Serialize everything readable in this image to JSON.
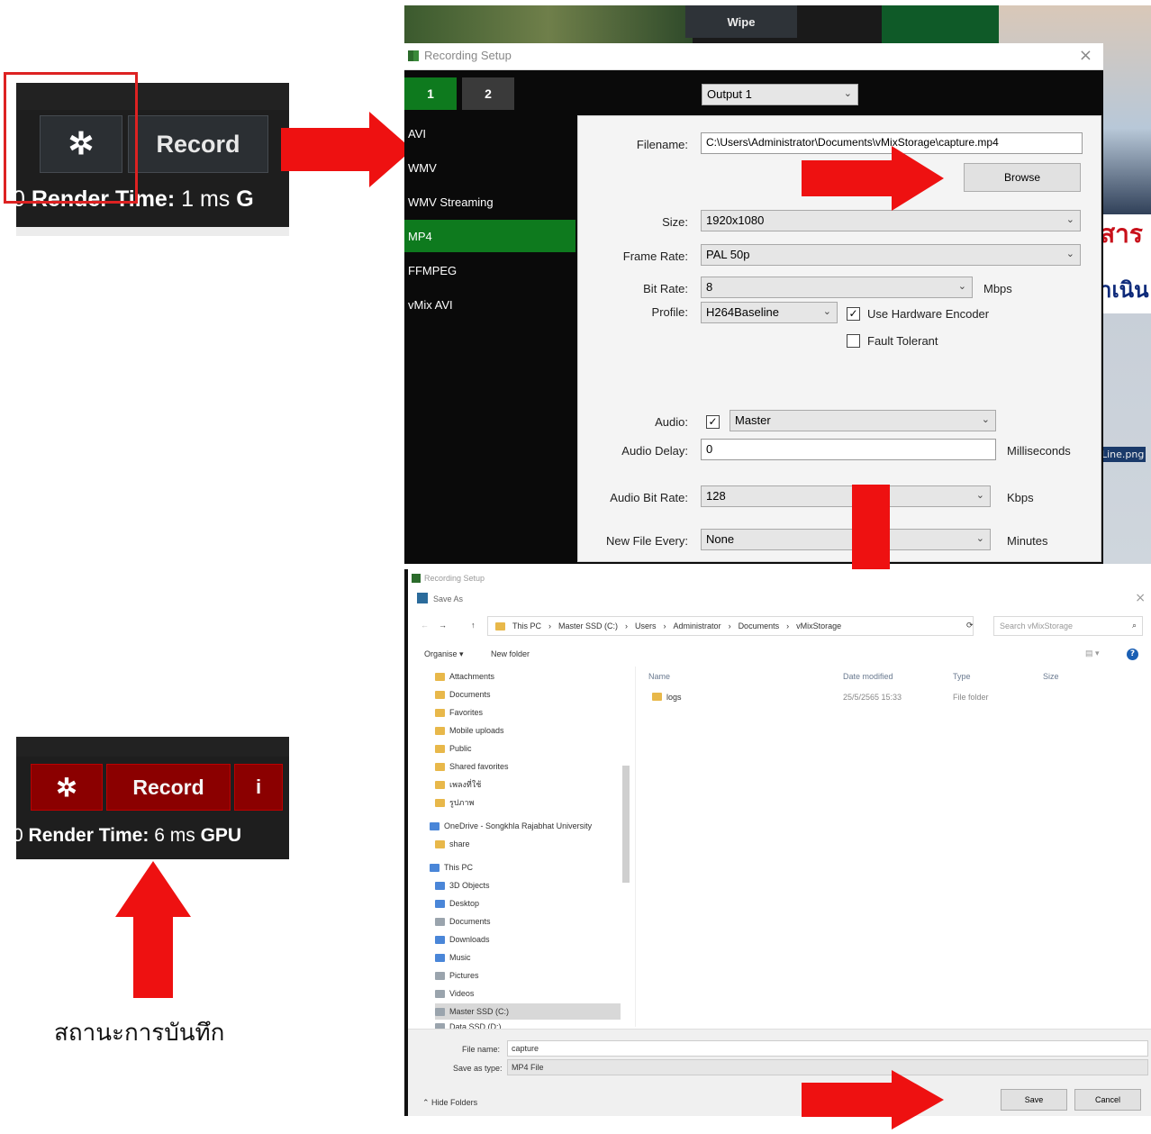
{
  "top_strip": {
    "record_label": "Record",
    "render_prefix": "0",
    "render_label": "Render Time:",
    "render_value": "1 ms",
    "render_suffix": "G"
  },
  "bottom_strip": {
    "record_label": "Record",
    "info_label": "i",
    "render_prefix": "0",
    "render_label": "Render Time:",
    "render_value": "6 ms",
    "gpu_label": "GPU"
  },
  "status_caption": "สถานะการบันทึก",
  "background": {
    "wipe_label": "Wipe",
    "thai_text_1": "สาร",
    "thai_text_2": "าเนิน",
    "side_text": "Line.png"
  },
  "recording_setup": {
    "title": "Recording Setup",
    "tabs": [
      "1",
      "2"
    ],
    "output_select": "Output 1",
    "formats": [
      "AVI",
      "WMV",
      "WMV Streaming",
      "MP4",
      "FFMPEG",
      "vMix AVI"
    ],
    "selected_format": "MP4",
    "filename_label": "Filename:",
    "filename_value": "C:\\Users\\Administrator\\Documents\\vMixStorage\\capture.mp4",
    "browse_label": "Browse",
    "size_label": "Size:",
    "size_value": "1920x1080",
    "frame_rate_label": "Frame Rate:",
    "frame_rate_value": "PAL 50p",
    "bit_rate_label": "Bit Rate:",
    "bit_rate_value": "8",
    "bit_rate_unit": "Mbps",
    "profile_label": "Profile:",
    "profile_value": "H264Baseline",
    "hw_encoder_label": "Use Hardware Encoder",
    "fault_tolerant_label": "Fault Tolerant",
    "audio_label": "Audio:",
    "audio_value": "Master",
    "audio_delay_label": "Audio Delay:",
    "audio_delay_value": "0",
    "audio_delay_unit": "Milliseconds",
    "audio_bit_rate_label": "Audio Bit Rate:",
    "audio_bit_rate_value": "128",
    "audio_bit_rate_unit": "Kbps",
    "new_file_label": "New File Every:",
    "new_file_value": "None",
    "new_file_unit": "Minutes"
  },
  "save_as": {
    "parent_title": "Recording Setup",
    "title": "Save As",
    "breadcrumb": [
      "This PC",
      "Master SSD (C:)",
      "Users",
      "Administrator",
      "Documents",
      "vMixStorage"
    ],
    "search_placeholder": "Search vMixStorage",
    "organise_label": "Organise ▾",
    "new_folder_label": "New folder",
    "nav_items": [
      "Attachments",
      "Documents",
      "Favorites",
      "Mobile uploads",
      "Public",
      "Shared favorites",
      "เพลงที่ใช้",
      "รูปภาพ",
      "OneDrive - Songkhla Rajabhat University",
      "share",
      "This PC",
      "3D Objects",
      "Desktop",
      "Documents",
      "Downloads",
      "Music",
      "Pictures",
      "Videos",
      "Master SSD (C:)",
      "Data SSD (D:)"
    ],
    "columns": {
      "name": "Name",
      "date": "Date modified",
      "type": "Type",
      "size": "Size"
    },
    "rows": [
      {
        "name": "logs",
        "date": "25/5/2565 15:33",
        "type": "File folder"
      }
    ],
    "file_name_label": "File name:",
    "file_name_value": "capture",
    "save_type_label": "Save as type:",
    "save_type_value": "MP4 File",
    "hide_folders_label": "Hide Folders",
    "save_label": "Save",
    "cancel_label": "Cancel"
  },
  "colors": {
    "arrow": "#ee1111",
    "highlight": "#dd2222",
    "mp4_selected": "#0e7a1e",
    "record_active": "#8b0000"
  }
}
